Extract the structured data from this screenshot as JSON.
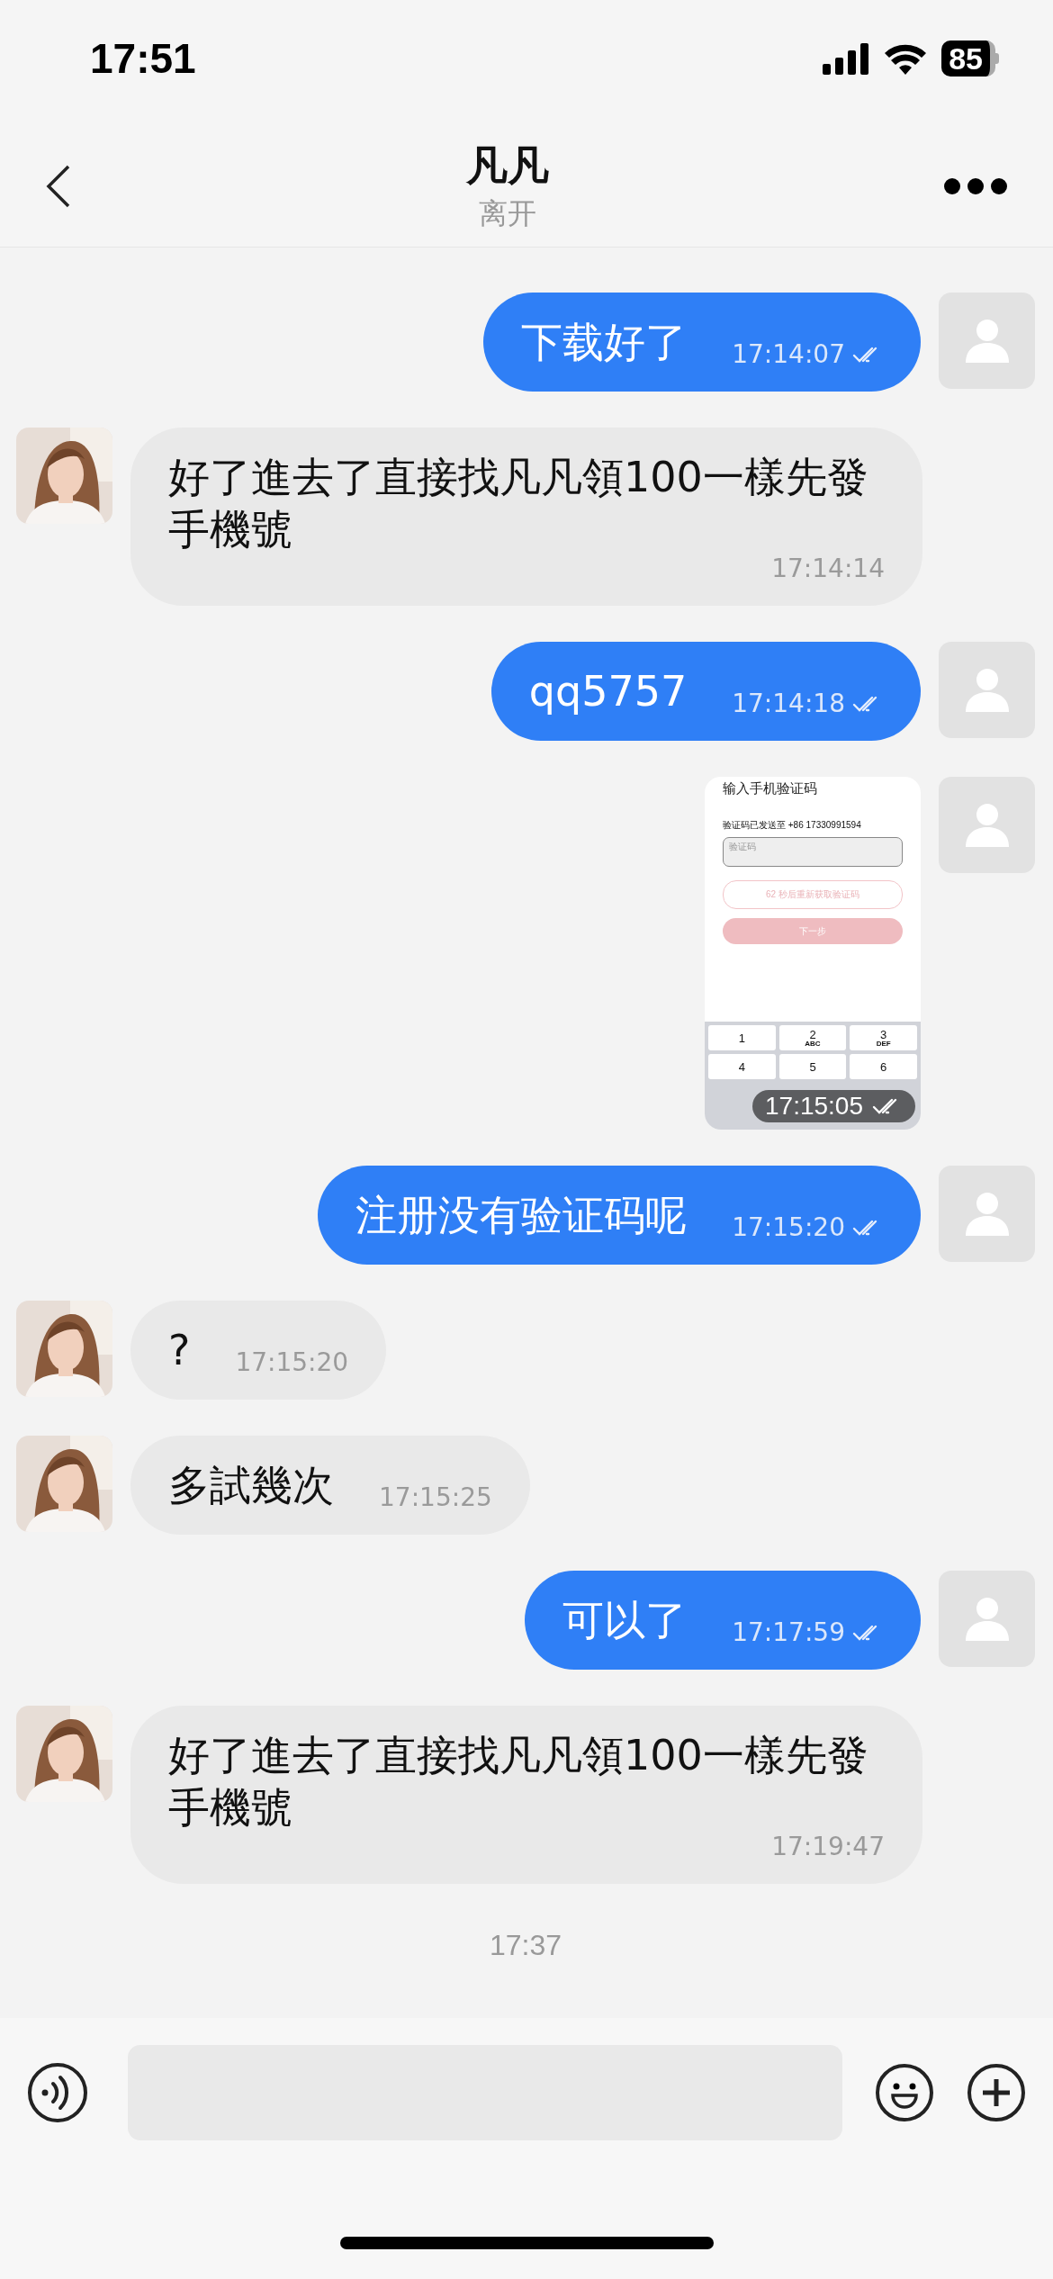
{
  "status_bar": {
    "time": "17:51",
    "battery": "85"
  },
  "header": {
    "title": "凡凡",
    "status": "离开"
  },
  "messages": [
    {
      "outgoing": true,
      "kind": "text",
      "text": "下载好了",
      "time": "17:14:07",
      "read": true
    },
    {
      "outgoing": false,
      "kind": "text",
      "text": "好了進去了直接找凡凡領100一樣先發手機號",
      "time": "17:14:14"
    },
    {
      "outgoing": true,
      "kind": "text",
      "text": "qq5757",
      "time": "17:14:18",
      "read": true
    },
    {
      "outgoing": true,
      "time": "17:15:05",
      "read": true,
      "screenshot": {
        "title": "输入手机验证码",
        "sent_to": "验证码已发送至 +86 17330991594",
        "placeholder": "验证码",
        "resend_button": "62 秒后重新获取验证码",
        "next_button": "下一步",
        "keys": [
          {
            "digit": "1"
          },
          {
            "digit": "2",
            "letters": "ABC"
          },
          {
            "digit": "3",
            "letters": "DEF"
          },
          {
            "digit": "4"
          },
          {
            "digit": "5"
          },
          {
            "digit": "6"
          }
        ]
      }
    },
    {
      "outgoing": true,
      "kind": "text",
      "text": "注册没有验证码呢",
      "time": "17:15:20",
      "read": true
    },
    {
      "outgoing": false,
      "kind": "text",
      "text": "?",
      "time": "17:15:20"
    },
    {
      "outgoing": false,
      "kind": "text",
      "text": "多試幾次",
      "time": "17:15:25"
    },
    {
      "outgoing": true,
      "kind": "text",
      "text": "可以了",
      "time": "17:17:59",
      "read": true
    },
    {
      "outgoing": false,
      "kind": "text",
      "text": "好了進去了直接找凡凡領100一樣先發手機號",
      "time": "17:19:47"
    },
    {
      "kind": "divider",
      "time": "17:37"
    }
  ]
}
